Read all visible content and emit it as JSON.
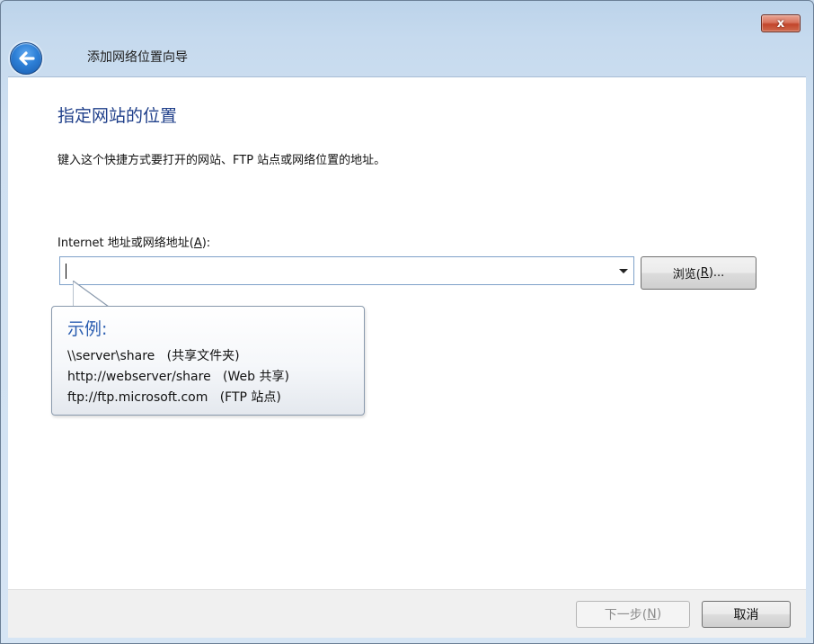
{
  "window": {
    "title": "添加网络位置向导",
    "close_glyph": "x",
    "close_icon": "close-icon",
    "back_icon": "back-arrow-icon"
  },
  "page": {
    "heading": "指定网站的位置",
    "description": "键入这个快捷方式要打开的网站、FTP 站点或网络位置的地址。"
  },
  "address": {
    "label_prefix": "Internet 地址或网络地址(",
    "label_accel": "A",
    "label_suffix": "):",
    "value": "",
    "browse_prefix": "浏览(",
    "browse_accel": "R",
    "browse_suffix": ")..."
  },
  "example_balloon": {
    "heading": "示例:",
    "lines": [
      "\\\\server\\share   (共享文件夹)",
      "http://webserver/share   (Web 共享)",
      "ftp://ftp.microsoft.com   (FTP 站点)"
    ]
  },
  "footer": {
    "next_prefix": "下一步(",
    "next_accel": "N",
    "next_suffix": ")",
    "cancel_label": "取消"
  },
  "colors": {
    "heading": "#1f3f8a",
    "balloon_heading": "#2a5db0",
    "close_button": "#c2452b"
  }
}
